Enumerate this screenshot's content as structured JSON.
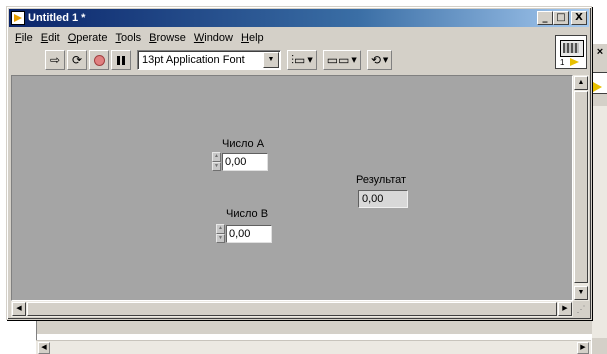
{
  "window": {
    "title": "Untitled 1 *",
    "controls": {
      "minimize": "_",
      "maximize": "□",
      "close": "X"
    }
  },
  "menubar": {
    "items": [
      {
        "label": "File"
      },
      {
        "label": "Edit"
      },
      {
        "label": "Operate"
      },
      {
        "label": "Tools"
      },
      {
        "label": "Browse"
      },
      {
        "label": "Window"
      },
      {
        "label": "Help"
      }
    ]
  },
  "toolbar": {
    "run_icon": "⇨",
    "run_continuous_icon": "⟳",
    "font_select_value": "13pt Application Font",
    "align_icon": "align-objects-icon",
    "distribute_icon": "distribute-objects-icon",
    "reorder_icon": "reorder-icon"
  },
  "connector_pane": {
    "number": "1"
  },
  "front_panel": {
    "control_a": {
      "label": "Число A",
      "value": "0,00"
    },
    "control_b": {
      "label": "Число B",
      "value": "0,00"
    },
    "indicator": {
      "label": "Результат",
      "value": "0,00"
    }
  },
  "colors": {
    "title_bar": "#0a246a",
    "panel_background": "#a5a5a5",
    "window_chrome": "#d4d0c8"
  }
}
